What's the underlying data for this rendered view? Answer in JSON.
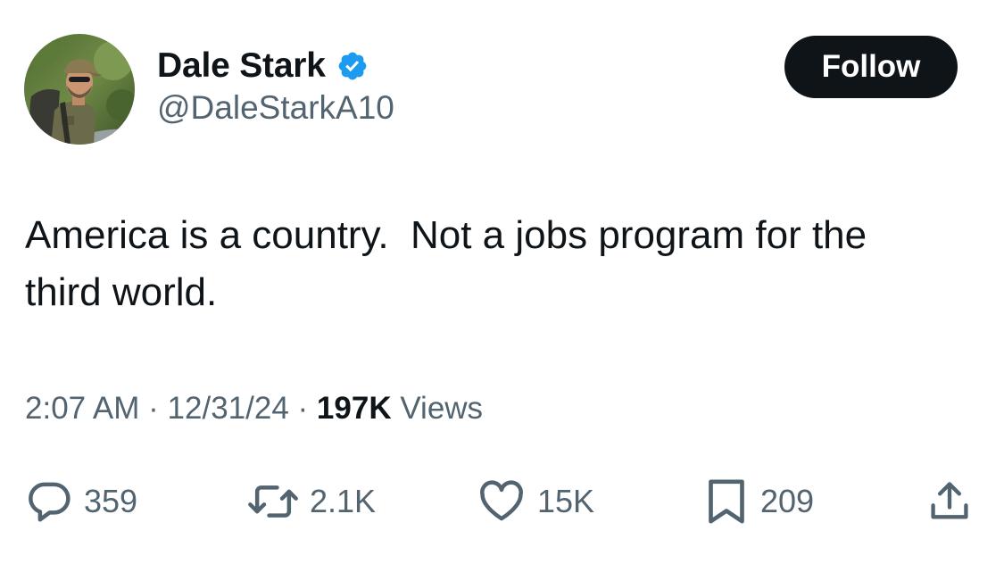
{
  "author": {
    "display_name": "Dale Stark",
    "handle": "@DaleStarkA10",
    "verified": true
  },
  "follow_button": {
    "label": "Follow"
  },
  "tweet": {
    "text": "America is a country.  Not a jobs program for the\nthird world.",
    "time": "2:07 AM",
    "separator": "·",
    "date": "12/31/24",
    "views_count": "197K",
    "views_label": "Views"
  },
  "actions": {
    "replies": {
      "icon": "reply-icon",
      "count": "359"
    },
    "reposts": {
      "icon": "repost-icon",
      "count": "2.1K"
    },
    "likes": {
      "icon": "heart-icon",
      "count": "15K"
    },
    "bookmarks": {
      "icon": "bookmark-icon",
      "count": "209"
    },
    "share": {
      "icon": "share-icon"
    }
  },
  "colors": {
    "text_primary": "#0f1419",
    "text_secondary": "#536471",
    "verified_blue": "#1d9bf0",
    "follow_button_bg": "#0f1419",
    "follow_button_text": "#ffffff"
  }
}
